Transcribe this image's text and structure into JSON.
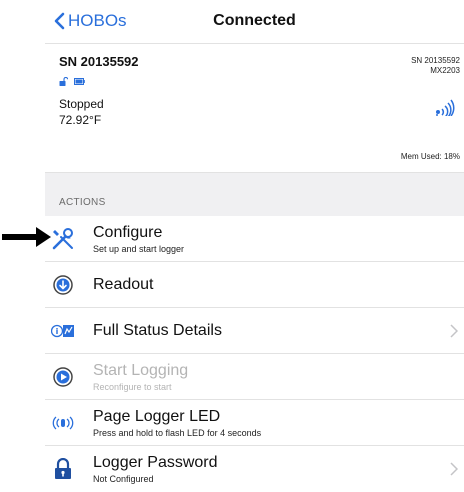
{
  "nav": {
    "back_label": "HOBOs",
    "title": "Connected"
  },
  "device": {
    "serial": "SN 20135592",
    "status": "Stopped",
    "temperature": "72.92°F",
    "serial_right": "SN 20135592",
    "model": "MX2203",
    "memory": "Mem Used: 18%"
  },
  "actions": {
    "header": "ACTIONS",
    "items": [
      {
        "title": "Configure",
        "subtitle": "Set up and start logger",
        "icon": "wrench-screwdriver-icon"
      },
      {
        "title": "Readout",
        "subtitle": "",
        "icon": "download-arrow-icon"
      },
      {
        "title": "Full Status Details",
        "subtitle": "",
        "icon": "status-details-icon"
      },
      {
        "title": "Start Logging",
        "subtitle": "Reconfigure to start",
        "icon": "play-icon"
      },
      {
        "title": "Page Logger LED",
        "subtitle": "Press and hold to flash LED for 4 seconds",
        "icon": "led-signal-icon"
      },
      {
        "title": "Logger Password",
        "subtitle": "Not Configured",
        "icon": "lock-icon"
      }
    ]
  },
  "colors": {
    "accent": "#2a6fdb",
    "disabled_text": "#b4b4b4",
    "section_bg": "#f0f0f2"
  }
}
